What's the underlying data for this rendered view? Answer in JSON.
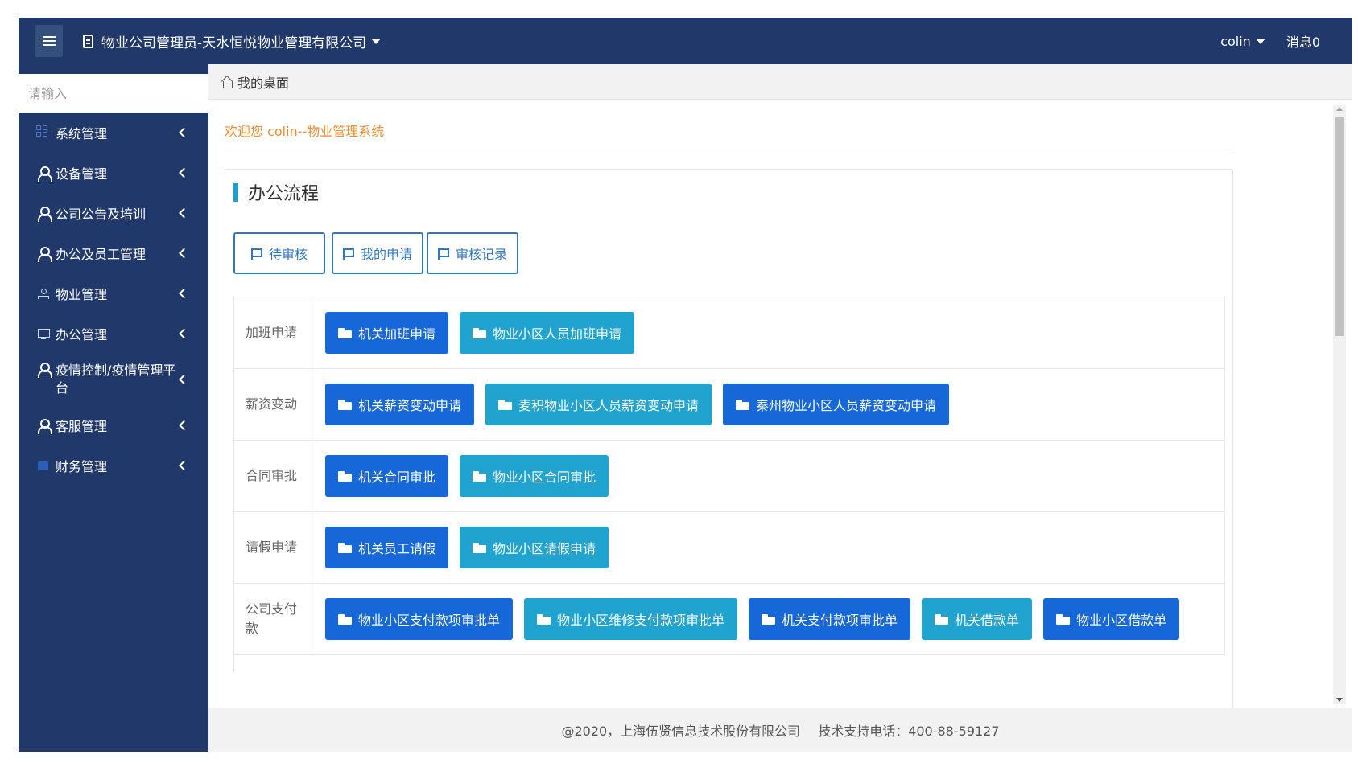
{
  "topbar": {
    "company": "物业公司管理员-天水恒悦物业管理有限公司",
    "user": "colin",
    "messages": "消息0"
  },
  "sidebar": {
    "search_placeholder": "请输入",
    "items": [
      {
        "label": "系统管理",
        "icon": "grid-icon"
      },
      {
        "label": "设备管理",
        "icon": "user-icon"
      },
      {
        "label": "公司公告及培训",
        "icon": "user-icon"
      },
      {
        "label": "办公及员工管理",
        "icon": "user-icon"
      },
      {
        "label": "物业管理",
        "icon": "tree-icon"
      },
      {
        "label": "办公管理",
        "icon": "screen-icon"
      },
      {
        "label": "疫情控制/疫情管理平台",
        "icon": "user-icon"
      },
      {
        "label": "客服管理",
        "icon": "user-icon"
      },
      {
        "label": "财务管理",
        "icon": "wallet-icon"
      }
    ]
  },
  "breadcrumb": {
    "label": "我的桌面"
  },
  "welcome": "欢迎您 colin--物业管理系统",
  "panel": {
    "title": "办公流程",
    "tabs": [
      "待审核",
      "我的申请",
      "审核记录"
    ],
    "rows": [
      {
        "label": "加班申请",
        "buttons": [
          "机关加班申请",
          "物业小区人员加班申请"
        ]
      },
      {
        "label": "薪资变动",
        "buttons": [
          "机关薪资变动申请",
          "麦积物业小区人员薪资变动申请",
          "秦州物业小区人员薪资变动申请"
        ]
      },
      {
        "label": "合同审批",
        "buttons": [
          "机关合同审批",
          "物业小区合同审批"
        ]
      },
      {
        "label": "请假申请",
        "buttons": [
          "机关员工请假",
          "物业小区请假申请"
        ]
      },
      {
        "label": "公司支付款",
        "buttons": [
          "物业小区支付款项审批单",
          "物业小区维修支付款项审批单",
          "机关支付款项审批单",
          "机关借款单",
          "物业小区借款单"
        ]
      }
    ]
  },
  "footer": {
    "copyright": "@2020，上海伍贤信息技术股份有限公司",
    "support": "技术支持电话：400-88-59127"
  },
  "colors": {
    "topbar": "#21386b",
    "primary_button": "#1668d8",
    "secondary_button": "#21a3cf",
    "welcome_text": "#f08c2e"
  }
}
